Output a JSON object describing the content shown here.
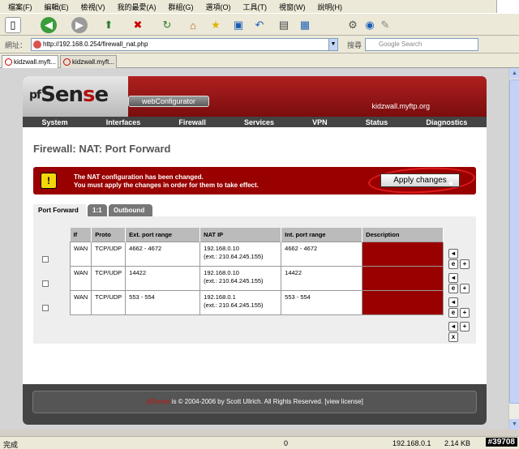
{
  "browser": {
    "menu": [
      "檔案(F)",
      "編輯(E)",
      "檢視(V)",
      "我的最愛(A)",
      "群組(G)",
      "選項(O)",
      "工具(T)",
      "視窗(W)",
      "說明(H)"
    ],
    "address_label": "網址：",
    "url": "http://192.168.0.254/firewall_nat.php",
    "search_label": "搜尋",
    "search_placeholder": "Google Search",
    "tabs": [
      "kidzwall.myft...",
      "kidzwall.myft..."
    ],
    "status": {
      "left": "完成",
      "count": "0",
      "ip": "192.168.0.1",
      "size": "2.14 KB",
      "watermark": "#39708"
    }
  },
  "header": {
    "logo_prefix": "pf",
    "logo_mid": "Sen",
    "logo_red": "s",
    "logo_end": "e",
    "webconfigurator": "webConfigurator",
    "hostname": "kidzwall.myftp.org"
  },
  "nav": [
    "System",
    "Interfaces",
    "Firewall",
    "Services",
    "VPN",
    "Status",
    "Diagnostics"
  ],
  "page_title": "Firewall: NAT: Port Forward",
  "alert": {
    "line1": "The NAT configuration has been changed.",
    "line2": "You must apply the changes in order for them to take effect.",
    "apply_button": "Apply changes"
  },
  "tabs": [
    "Port Forward",
    "1:1",
    "Outbound"
  ],
  "table": {
    "columns": [
      "If",
      "Proto",
      "Ext. port range",
      "NAT IP",
      "Int. port range",
      "Description"
    ],
    "rows": [
      {
        "if": "WAN",
        "proto": "TCP/UDP",
        "ext": "4662 - 4672",
        "nat_ip": "192.168.0.10",
        "nat_ext": "(ext.: 210.64.245.155)",
        "int": "4662 - 4672",
        "desc": ""
      },
      {
        "if": "WAN",
        "proto": "TCP/UDP",
        "ext": "14422",
        "nat_ip": "192.168.0.10",
        "nat_ext": "(ext.: 210.64.245.155)",
        "int": "14422",
        "desc": ""
      },
      {
        "if": "WAN",
        "proto": "TCP/UDP",
        "ext": "553 - 554",
        "nat_ip": "192.168.0.1",
        "nat_ext": "(ext.: 210.64.245.155)",
        "int": "553 - 554",
        "desc": ""
      }
    ]
  },
  "footer": {
    "brand": "pfSense",
    "text": " is © 2004-2006 by Scott Ullrich. All Rights Reserved. [view license]"
  },
  "colors": {
    "brand_red": "#990000",
    "nav_bg": "#444444"
  }
}
